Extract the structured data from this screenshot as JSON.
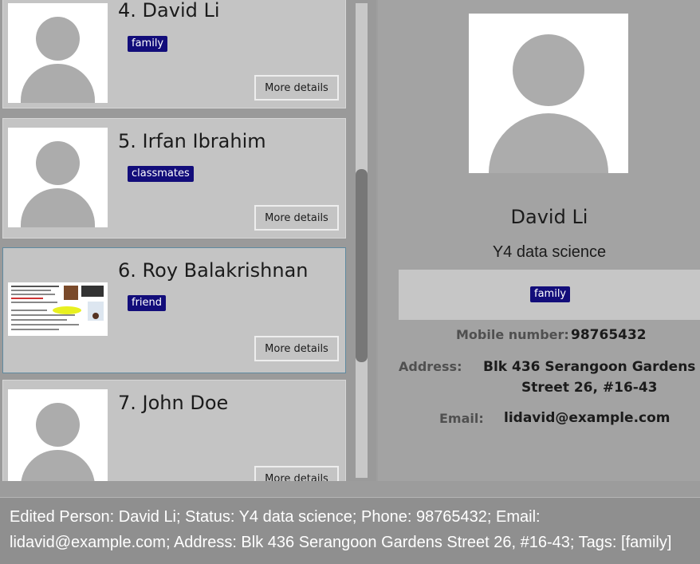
{
  "person_list": {
    "more_label": "More details",
    "cards": [
      {
        "index": "4.",
        "name": "David Li",
        "tag": "family",
        "photo": "default-avatar"
      },
      {
        "index": "5.",
        "name": "Irfan Ibrahim",
        "tag": "classmates",
        "photo": "default-avatar"
      },
      {
        "index": "6.",
        "name": "Roy Balakrishnan",
        "tag": "friend",
        "photo": "screenshot-thumbnail"
      },
      {
        "index": "7.",
        "name": "John Doe",
        "tag": "",
        "photo": "default-avatar"
      }
    ]
  },
  "detail": {
    "name": "David Li",
    "status": "Y4 data science",
    "tag": "family",
    "mobile_label": "Mobile number:",
    "mobile": "98765432",
    "address_label": "Address:",
    "address_line1": "Blk 436 Serangoon Gardens",
    "address_line2": "Street 26, #16-43",
    "email_label": "Email:",
    "email": "lidavid@example.com"
  },
  "result": {
    "text": "Edited Person: David Li; Status: Y4 data science; Phone: 98765432; Email: lidavid@example.com; Address: Blk 436 Serangoon Gardens Street 26, #16-43; Tags: [family]"
  },
  "colors": {
    "tag_background": "#120d7a",
    "card_background": "#c4c4c4",
    "selected_border": "#5f8aa0"
  },
  "scrollbar": {
    "position_fraction": 0.36
  }
}
